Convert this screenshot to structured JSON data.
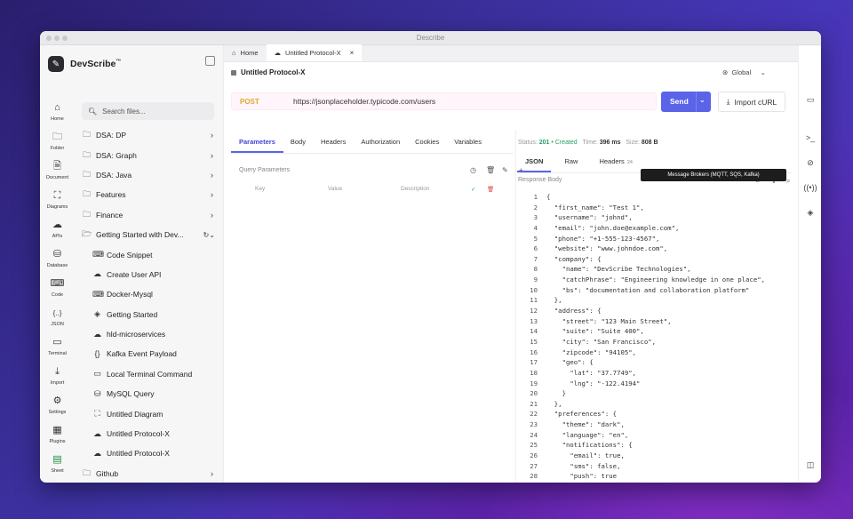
{
  "window": {
    "title": "Describe"
  },
  "brand": {
    "name": "DevScribe",
    "tm": "™"
  },
  "rail": [
    {
      "label": "Home",
      "icon": "⌂",
      "name": "home"
    },
    {
      "label": "Folder",
      "icon": "🗀",
      "name": "folder"
    },
    {
      "label": "Document",
      "icon": "🗎",
      "name": "document"
    },
    {
      "label": "Diagrams",
      "icon": "⛶",
      "name": "diagrams"
    },
    {
      "label": "APIs",
      "icon": "☁",
      "name": "apis"
    },
    {
      "label": "Database",
      "icon": "⛁",
      "name": "database"
    },
    {
      "label": "Code",
      "icon": "⌨",
      "name": "code"
    },
    {
      "label": "JSON",
      "icon": "{..}",
      "name": "json"
    },
    {
      "label": "Terminal",
      "icon": "▭",
      "name": "terminal"
    },
    {
      "label": "Import",
      "icon": "⤓",
      "name": "import"
    },
    {
      "label": "Settings",
      "icon": "⚙",
      "name": "settings"
    },
    {
      "label": "Plugins",
      "icon": "▦",
      "name": "plugins"
    },
    {
      "label": "Sheet",
      "icon": "▤",
      "name": "sheet"
    }
  ],
  "search": {
    "placeholder": "Search files..."
  },
  "tree": [
    {
      "label": "DSA: DP",
      "type": "folder"
    },
    {
      "label": "DSA: Graph",
      "type": "folder"
    },
    {
      "label": "DSA: Java",
      "type": "folder"
    },
    {
      "label": "Features",
      "type": "folder"
    },
    {
      "label": "Finance",
      "type": "folder"
    },
    {
      "label": "Getting Started with Dev...",
      "type": "folder-open"
    },
    {
      "label": "Code Snippet",
      "type": "child",
      "icon": "⌨"
    },
    {
      "label": "Create User API",
      "type": "child",
      "icon": "☁"
    },
    {
      "label": "Docker-Mysql",
      "type": "child",
      "icon": "⌨"
    },
    {
      "label": "Getting Started",
      "type": "child",
      "icon": "◈"
    },
    {
      "label": "hld-microservices",
      "type": "child",
      "icon": "☁"
    },
    {
      "label": "Kafka Event Payload",
      "type": "child",
      "icon": "{}"
    },
    {
      "label": "Local Terminal Command",
      "type": "child",
      "icon": "▭"
    },
    {
      "label": "MySQL Query",
      "type": "child",
      "icon": "⛁"
    },
    {
      "label": "Untitled Diagram",
      "type": "child",
      "icon": "⛶"
    },
    {
      "label": "Untitled Protocol-X",
      "type": "child",
      "icon": "☁"
    },
    {
      "label": "Untitled Protocol-X",
      "type": "child",
      "icon": "☁"
    },
    {
      "label": "Github",
      "type": "folder"
    }
  ],
  "tabs": [
    {
      "label": "Home"
    },
    {
      "label": "Untitled Protocol-X"
    }
  ],
  "request": {
    "title": "Untitled Protocol-X",
    "env": "Global",
    "method": "POST",
    "url": "https://jsonplaceholder.typicode.com/users",
    "send": "Send",
    "import": "Import cURL"
  },
  "req_tabs": [
    "Parameters",
    "Body",
    "Headers",
    "Authorization",
    "Cookies",
    "Variables"
  ],
  "params": {
    "label": "Query Parameters",
    "cols": [
      "Key",
      "Value",
      "Description"
    ]
  },
  "status": {
    "label": "Status:",
    "code": "201",
    "text": "Created",
    "time_label": "Time:",
    "time": "396 ms",
    "size_label": "Size:",
    "size": "808 B",
    "sep": "•"
  },
  "resp_tabs": [
    {
      "label": "JSON"
    },
    {
      "label": "Raw"
    },
    {
      "label": "Headers",
      "count": "24"
    }
  ],
  "response_body_label": "Response Body",
  "tooltip": "Message Brokers (MQTT, SQS, Kafka)",
  "code": [
    "{",
    "  \"first_name\": \"Test 1\",",
    "  \"username\": \"johnd\",",
    "  \"email\": \"john.doe@example.com\",",
    "  \"phone\": \"+1-555-123-4567\",",
    "  \"website\": \"www.johndoe.com\",",
    "  \"company\": {",
    "    \"name\": \"DevScribe Technologies\",",
    "    \"catchPhrase\": \"Engineering knowledge in one place\",",
    "    \"bs\": \"documentation and collaboration platform\"",
    "  },",
    "  \"address\": {",
    "    \"street\": \"123 Main Street\",",
    "    \"suite\": \"Suite 400\",",
    "    \"city\": \"San Francisco\",",
    "    \"zipcode\": \"94105\",",
    "    \"geo\": {",
    "      \"lat\": \"37.7749\",",
    "      \"lng\": \"-122.4194\"",
    "    }",
    "  },",
    "  \"preferences\": {",
    "    \"theme\": \"dark\",",
    "    \"language\": \"en\",",
    "    \"notifications\": {",
    "      \"email\": true,",
    "      \"sms\": false,",
    "      \"push\": true",
    "    }",
    "  }"
  ],
  "colors": {
    "accent": "#5b63e8",
    "post": "#e0a82e",
    "created": "#2a9d68"
  }
}
